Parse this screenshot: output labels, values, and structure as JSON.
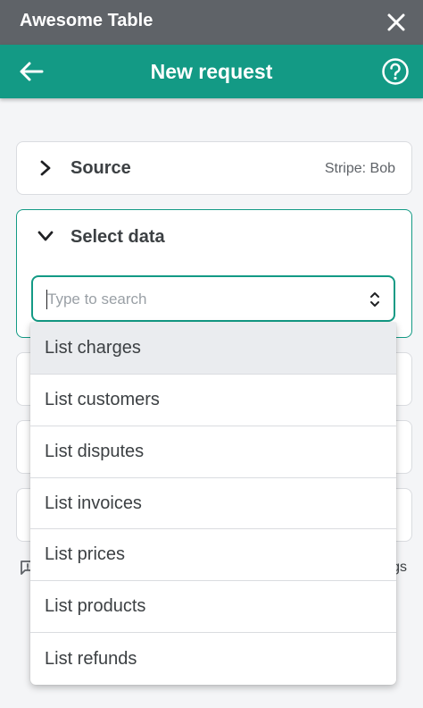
{
  "window": {
    "title": "Awesome Table"
  },
  "header": {
    "title": "New request"
  },
  "source": {
    "label": "Source",
    "value": "Stripe: Bob"
  },
  "select_data": {
    "label": "Select data",
    "search_placeholder": "Type to search",
    "options": [
      "List charges",
      "List customers",
      "List disputes",
      "List invoices",
      "List prices",
      "List products",
      "List refunds"
    ],
    "highlighted_option": "List charges"
  },
  "partial_text": {
    "right_fragment": "gs"
  },
  "colors": {
    "titlebar": "#5f6368",
    "accent": "#139a85"
  }
}
